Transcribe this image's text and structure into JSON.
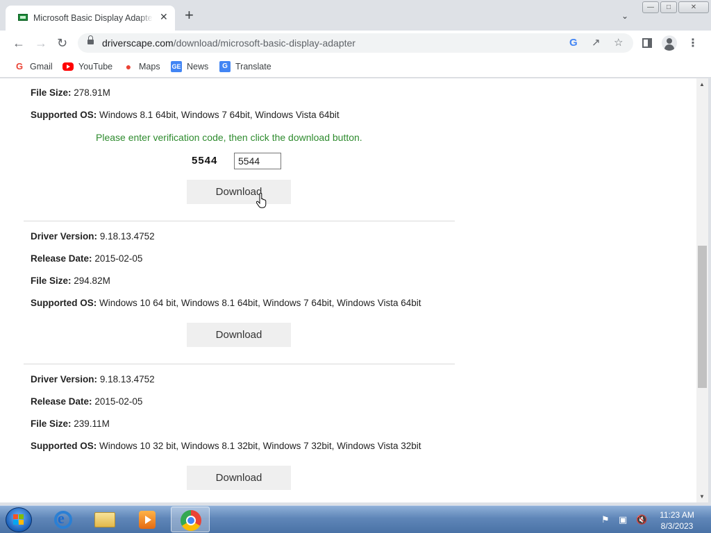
{
  "browser": {
    "tab_title": "Microsoft Basic Display Adapter (",
    "tab_close": "✕",
    "new_tab": "+",
    "url_host": "driverscape.com",
    "url_path": "/download/microsoft-basic-display-adapter",
    "bookmarks": [
      {
        "label": "Gmail",
        "icon": "gmail-icon"
      },
      {
        "label": "YouTube",
        "icon": "youtube-icon"
      },
      {
        "label": "Maps",
        "icon": "maps-icon"
      },
      {
        "label": "News",
        "icon": "news-icon"
      },
      {
        "label": "Translate",
        "icon": "translate-icon"
      }
    ]
  },
  "page": {
    "labels": {
      "driver_version": "Driver Version:",
      "release_date": "Release Date:",
      "file_size": "File Size:",
      "supported_os": "Supported OS:"
    },
    "entry1": {
      "file_size": "278.91M",
      "supported_os": "Windows 8.1 64bit, Windows 7 64bit, Windows Vista 64bit",
      "verify_message": "Please enter verification code, then click the download button.",
      "captcha_code": "5544",
      "input_value": "5544",
      "button": "Download"
    },
    "entry2": {
      "driver_version": "9.18.13.4752",
      "release_date": "2015-02-05",
      "file_size": "294.82M",
      "supported_os": "Windows 10 64 bit, Windows 8.1 64bit, Windows 7 64bit, Windows Vista 64bit",
      "button": "Download"
    },
    "entry3": {
      "driver_version": "9.18.13.4752",
      "release_date": "2015-02-05",
      "file_size": "239.11M",
      "supported_os": "Windows 10 32 bit, Windows 8.1 32bit, Windows 7 32bit, Windows Vista 32bit",
      "button": "Download"
    }
  },
  "taskbar": {
    "time": "11:23 AM",
    "date": "8/3/2023"
  },
  "colors": {
    "verify_text": "#2e8b2e",
    "button_bg": "#efefef",
    "taskbar": "#5f86b8"
  }
}
